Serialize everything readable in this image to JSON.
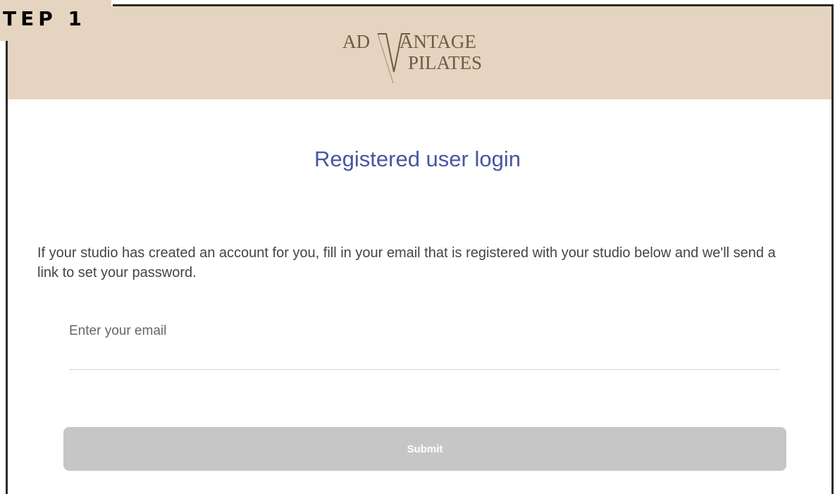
{
  "step_tag": {
    "label": "TEP 1"
  },
  "header": {
    "logo_line1_left": "AD",
    "logo_line1_right": "ANTAGE",
    "logo_line2": "PILATES",
    "background_color": "#e5d5c0"
  },
  "main": {
    "title": "Registered user login",
    "description": "If your studio has created an account for you, fill in your email that is registered with your studio below and we'll send a link to set your password.",
    "email": {
      "placeholder": "Enter your email",
      "value": ""
    },
    "submit_label": "Submit"
  },
  "colors": {
    "title": "#4657a0",
    "button": "#c6c6c6",
    "logo": "#6e5a45"
  }
}
